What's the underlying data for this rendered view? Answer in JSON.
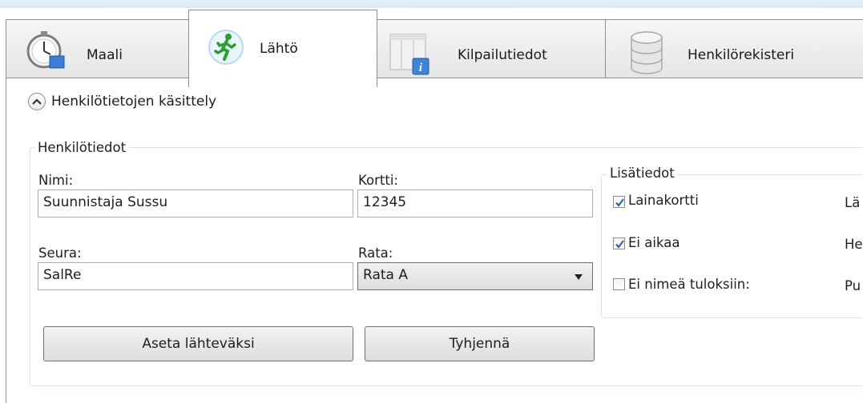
{
  "tabs": [
    {
      "label": "Maali",
      "icon": "stopwatch-icon",
      "active": false
    },
    {
      "label": "Lähtö",
      "icon": "runner-icon",
      "active": true
    },
    {
      "label": "Kilpailutiedot",
      "icon": "info-window-icon",
      "active": false
    },
    {
      "label": "Henkilörekisteri",
      "icon": "database-icon",
      "active": false
    }
  ],
  "section": {
    "expander_label": "Henkilötietojen käsittely"
  },
  "person": {
    "group_title": "Henkilötiedot",
    "name_label": "Nimi:",
    "name_value": "Suunnistaja Sussu",
    "card_label": "Kortti:",
    "card_value": "12345",
    "club_label": "Seura:",
    "club_value": "SalRe",
    "course_label": "Rata:",
    "course_value": "Rata A"
  },
  "extra": {
    "group_title": "Lisätiedot",
    "checkboxes": [
      {
        "label": "Lainakortti",
        "checked": true
      },
      {
        "label": "Ei aikaa",
        "checked": true
      },
      {
        "label": "Ei nimeä tuloksiin:",
        "checked": false
      }
    ],
    "cut_labels": [
      "Lä",
      "He",
      "Pu"
    ]
  },
  "buttons": {
    "set_start": "Aseta lähteväksi",
    "clear": "Tyhjennä"
  },
  "colors": {
    "accent_check": "#2a62b8",
    "runner_green": "#2aa02a",
    "tab_border": "#8e8f8f"
  }
}
